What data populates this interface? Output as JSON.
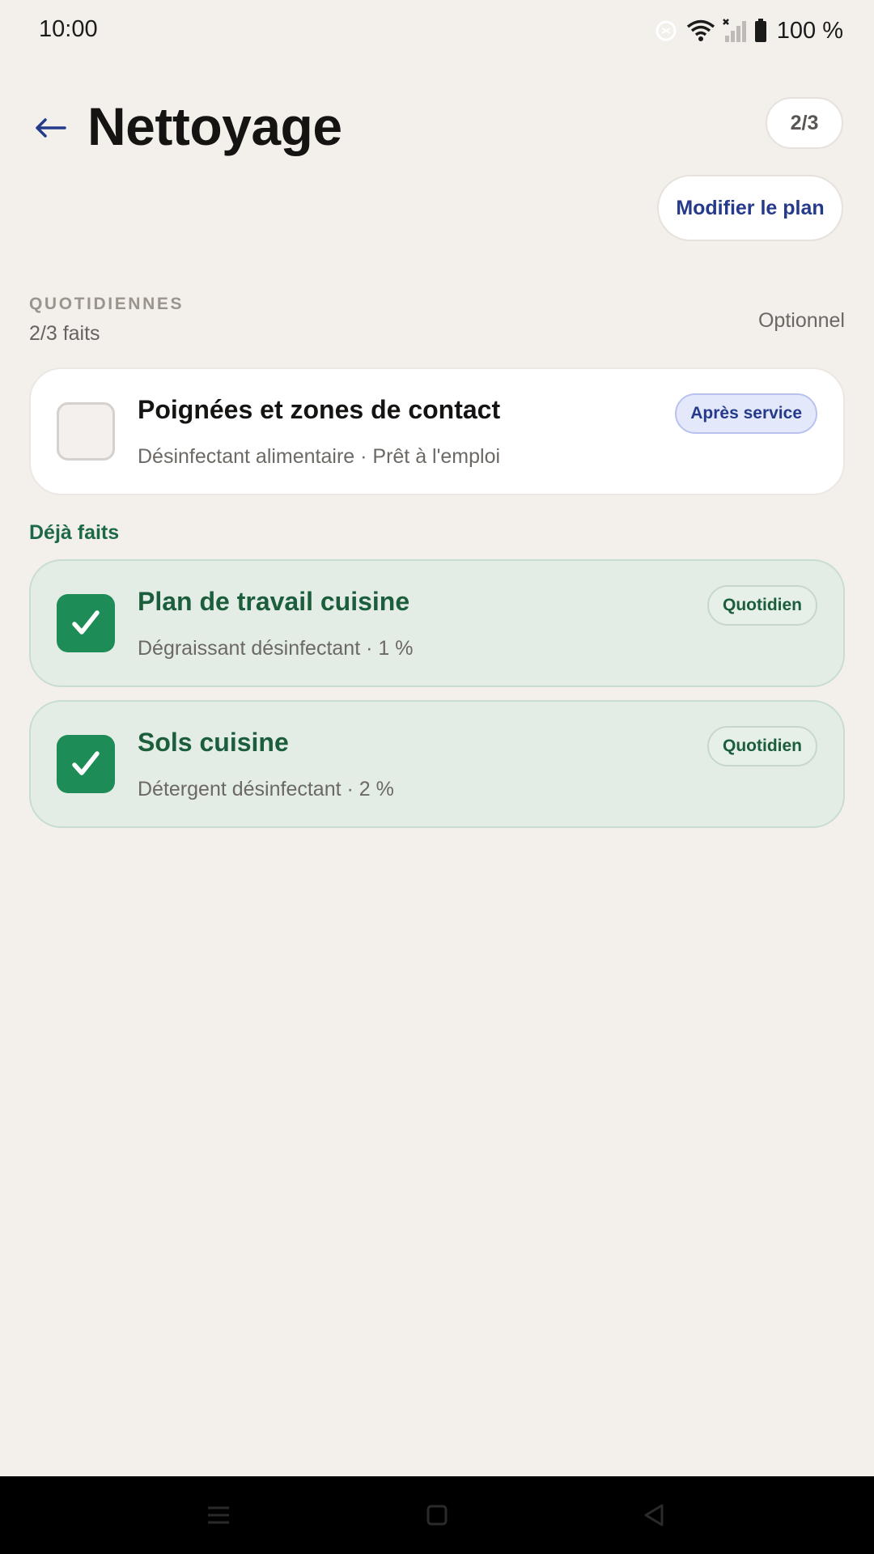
{
  "status_bar": {
    "time": "10:00",
    "battery": "100 %",
    "icons": [
      "data-saver-icon",
      "wifi-icon",
      "signal-icon",
      "battery-icon"
    ]
  },
  "header": {
    "title": "Nettoyage",
    "progress": "2/3",
    "edit_plan": "Modifier le plan"
  },
  "section": {
    "label": "QUOTIDIENNES",
    "count": "2/3 faits",
    "optional": "Optionnel"
  },
  "pending_tasks": [
    {
      "title": "Poignées et zones de contact",
      "subtitle": "Désinfectant alimentaire · Prêt à l'emploi",
      "badge": "Après service",
      "checked": false
    }
  ],
  "done_label": "Déjà faits",
  "done_tasks": [
    {
      "title": "Plan de travail cuisine",
      "subtitle": "Dégraissant désinfectant · 1 %",
      "badge": "Quotidien",
      "checked": true
    },
    {
      "title": "Sols cuisine",
      "subtitle": "Détergent désinfectant · 2 %",
      "badge": "Quotidien",
      "checked": true
    }
  ],
  "colors": {
    "background": "#f3efeb",
    "accent_blue": "#253a8a",
    "done_green": "#1e8c57",
    "done_card": "#e3ede6"
  },
  "nav_bar": {
    "icons": [
      "menu-icon",
      "home-icon",
      "back-icon"
    ]
  }
}
